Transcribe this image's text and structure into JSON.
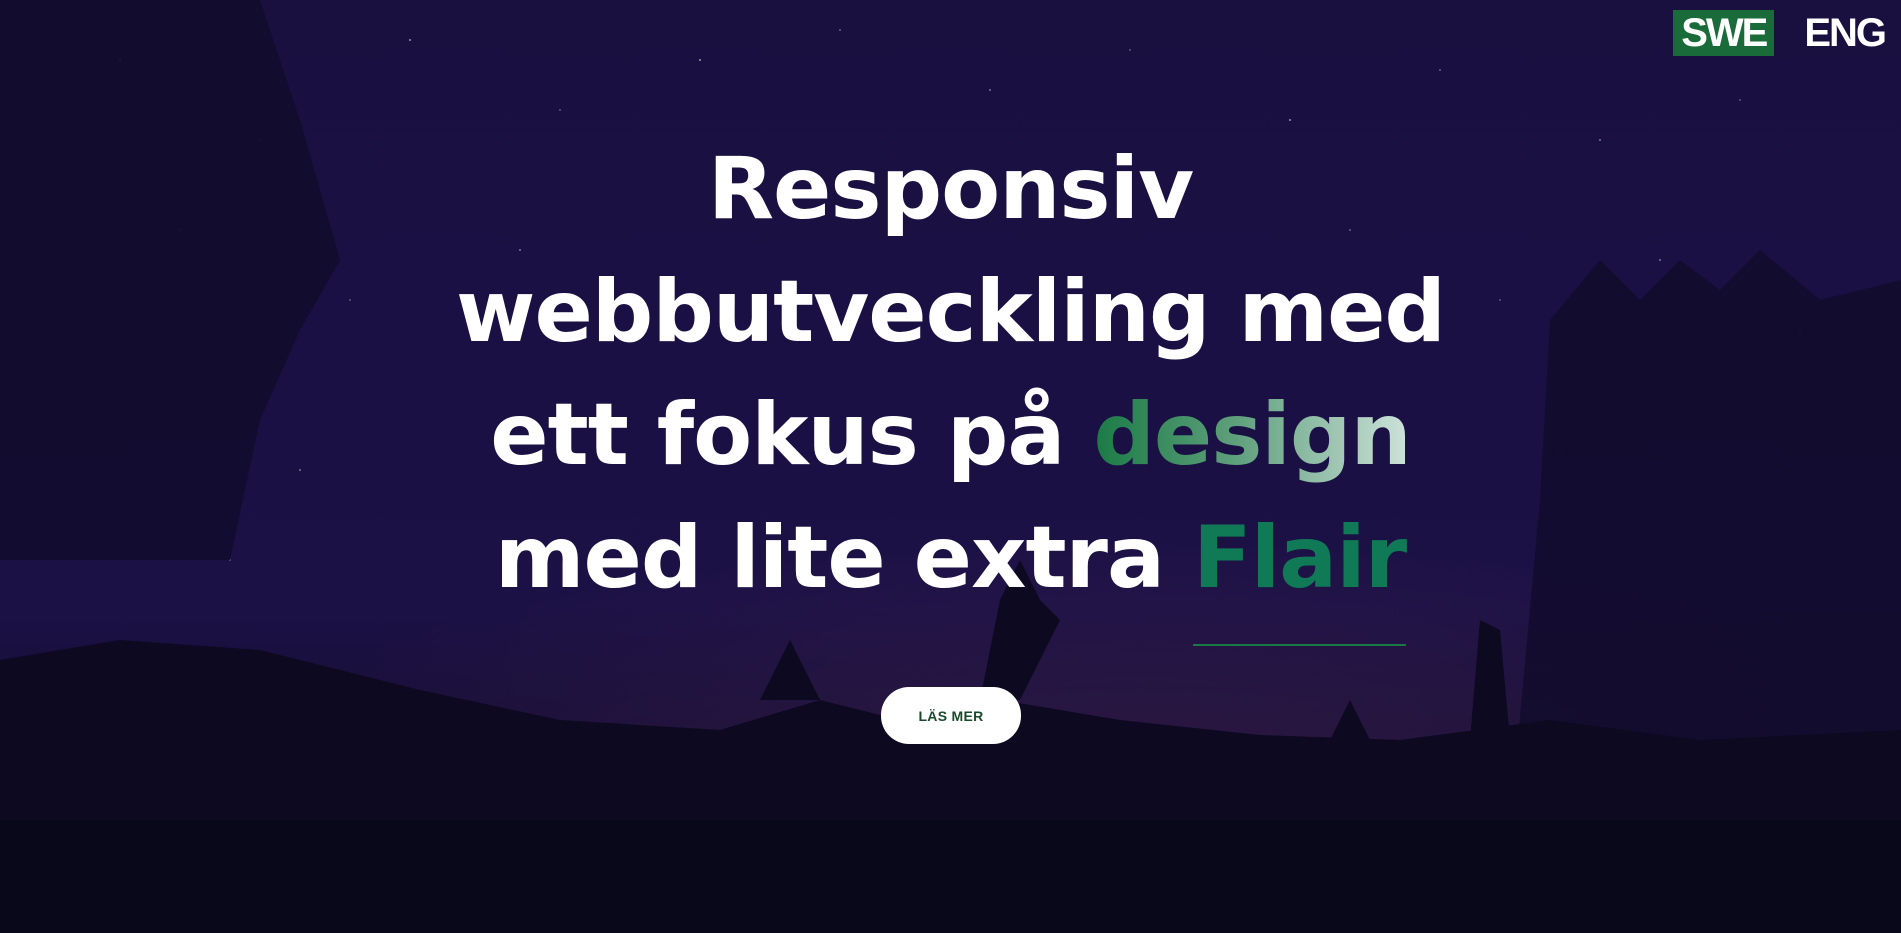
{
  "language_switch": {
    "options": [
      {
        "label": "SWE",
        "active": true
      },
      {
        "label": "ENG",
        "active": false
      }
    ],
    "active_color": "#1a6b3a"
  },
  "hero": {
    "headline": {
      "line1": "Responsiv",
      "line2": "webbutveckling med",
      "line3_prefix": "ett fokus på ",
      "line3_highlight": "design",
      "line4_prefix": "med lite extra ",
      "line4_highlight": "Flair"
    },
    "cta_label": "LÄS MER",
    "accent_color": "#0f7a55"
  }
}
